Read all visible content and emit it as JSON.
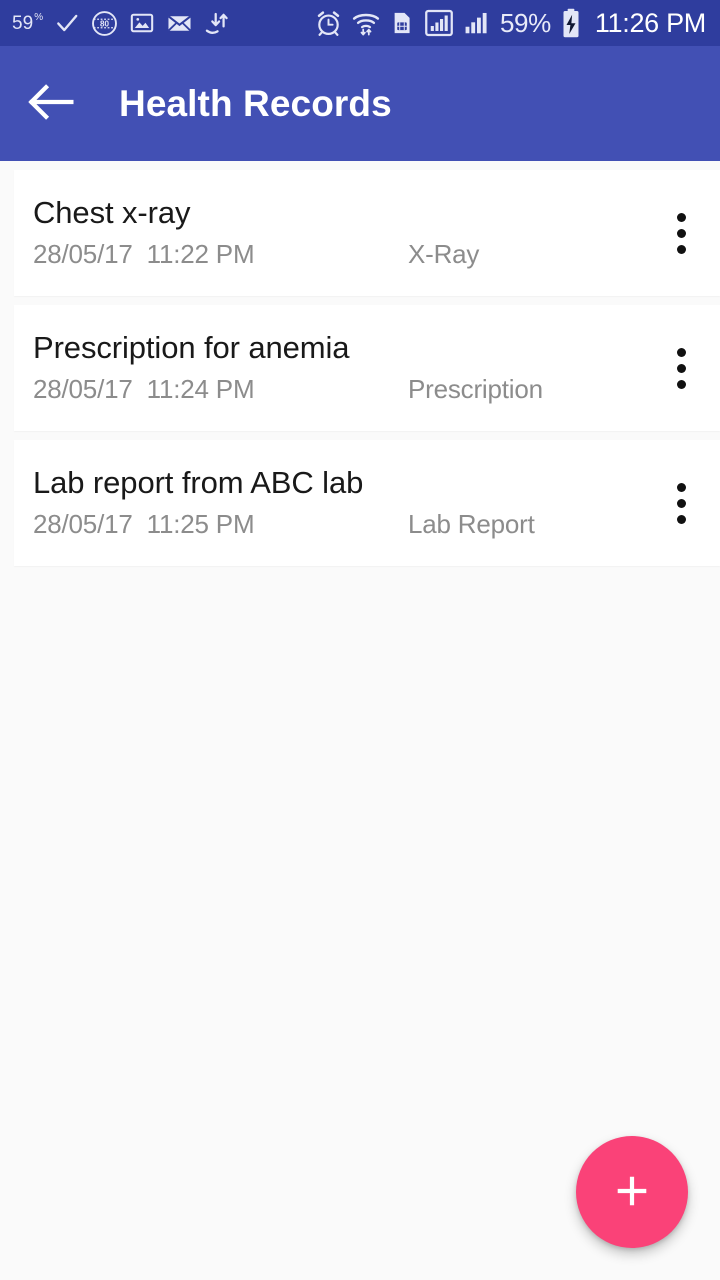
{
  "status_bar": {
    "background_color": "#2F3D9E",
    "left_icons": [
      {
        "name": "data-saver-percent",
        "label": "59",
        "suffix": "%"
      },
      {
        "name": "check-icon",
        "label": "check"
      },
      {
        "name": "film-80-badge-icon",
        "label": "80"
      },
      {
        "name": "image-icon",
        "label": "image"
      },
      {
        "name": "envelope-icon",
        "label": "mail"
      },
      {
        "name": "data-transfer-icon",
        "label": "transfer"
      }
    ],
    "right_icons": [
      {
        "name": "alarm-clock-icon",
        "label": "alarm"
      },
      {
        "name": "wifi-icon",
        "label": "wifi"
      },
      {
        "name": "sim-card-icon",
        "label": "sim"
      },
      {
        "name": "signal-boxed-icon",
        "label": "signal-1"
      },
      {
        "name": "signal-bars-icon",
        "label": "signal-2"
      }
    ],
    "battery_percent": "59%",
    "battery_charging": true,
    "clock": "11:26 PM"
  },
  "app_bar": {
    "background_color": "#4250B4",
    "title": "Health Records",
    "back_label": "Back"
  },
  "records": [
    {
      "title": "Chest x-ray",
      "datetime": "28/05/17  11:22 PM",
      "category": "X-Ray",
      "overflow_label": "More options"
    },
    {
      "title": "Prescription for anemia",
      "datetime": "28/05/17  11:24 PM",
      "category": "Prescription",
      "overflow_label": "More options"
    },
    {
      "title": "Lab report from ABC lab",
      "datetime": "28/05/17  11:25 PM",
      "category": "Lab Report",
      "overflow_label": "More options"
    }
  ],
  "fab": {
    "label": "Add record",
    "icon": "plus-icon",
    "color": "#FA4278"
  },
  "theme": {
    "page_background": "#FAFAFA",
    "card_background": "#FFFFFF",
    "primary": "#4250B4",
    "primary_dark": "#2F3D9E",
    "accent": "#FA4278",
    "title_text": "#191919",
    "secondary_text": "#8C8C8C"
  }
}
